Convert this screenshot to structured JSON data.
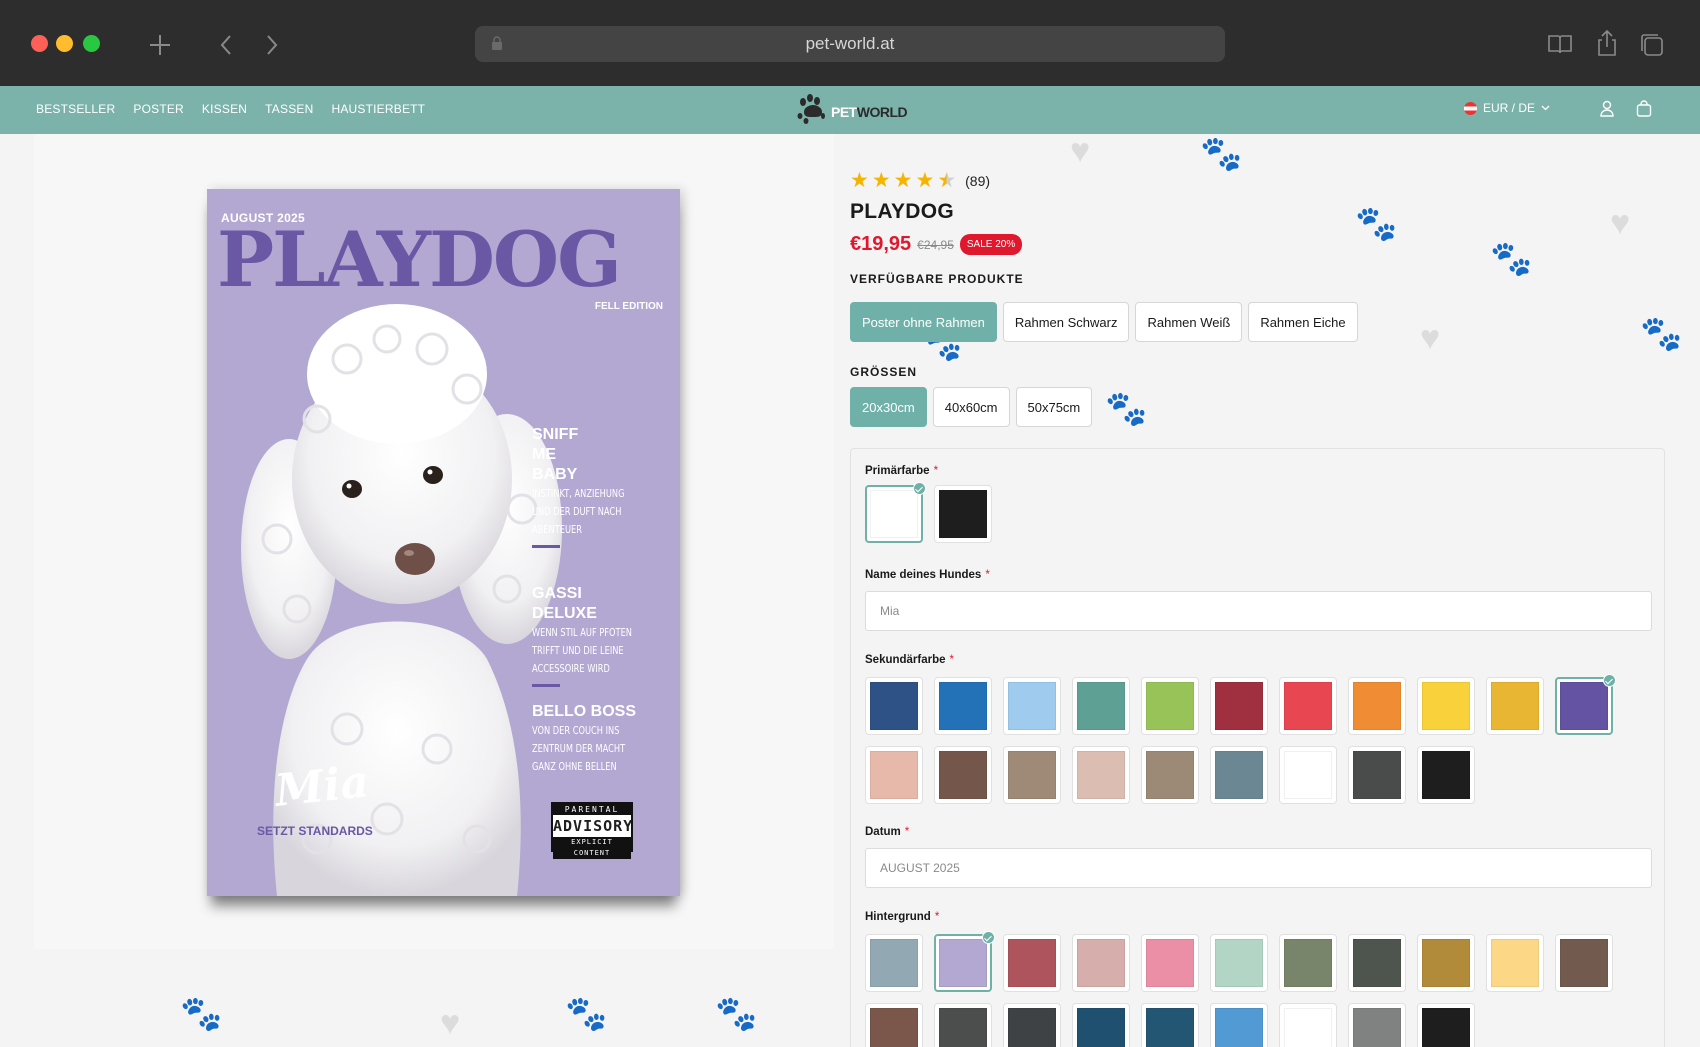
{
  "browser": {
    "url": "pet-world.at"
  },
  "nav": {
    "links": [
      "BESTSELLER",
      "POSTER",
      "KISSEN",
      "TASSEN",
      "HAUSTIERBETT"
    ],
    "logo_pet": "PET",
    "logo_world": "WORLD",
    "locale": "EUR / DE"
  },
  "poster": {
    "date": "AUGUST 2025",
    "title": "PLAYDOG",
    "edition": "FELL EDITION",
    "headlines": [
      {
        "title1": "SNIFF",
        "title2": "ME",
        "title3": "BABY",
        "sub1": "INSTINKT, ANZIEHUNG",
        "sub2": "UND DER DUFT NACH",
        "sub3": "ABENTEUER"
      },
      {
        "title1": "GASSI",
        "title2": "DELUXE",
        "sub1": "WENN STIL AUF PFOTEN",
        "sub2": "TRIFFT UND DIE LEINE",
        "sub3": "ACCESSOIRE WIRD"
      },
      {
        "title1": "BELLO BOSS",
        "sub1": "VON DER COUCH INS",
        "sub2": "ZENTRUM DER MACHT",
        "sub3": "GANZ OHNE BELLEN"
      }
    ],
    "name": "Mia",
    "tagline": "SETZT STANDARDS",
    "advisory": {
      "top": "PARENTAL",
      "mid": "ADVISORY",
      "bottom": "EXPLICIT CONTENT"
    }
  },
  "product": {
    "rating_value": 4.5,
    "rating_count": "(89)",
    "title": "PLAYDOG",
    "price_now": "€19,95",
    "price_was": "€24,95",
    "sale_badge": "SALE 20%",
    "products_label": "VERFÜGBARE PRODUKTE",
    "products": [
      "Poster ohne Rahmen",
      "Rahmen Schwarz",
      "Rahmen Weiß",
      "Rahmen Eiche"
    ],
    "products_selected": "Poster ohne Rahmen",
    "sizes_label": "GRÖSSEN",
    "sizes": [
      "20x30cm",
      "40x60cm",
      "50x75cm"
    ],
    "size_selected": "20x30cm"
  },
  "form": {
    "primary_label": "Primärfarbe",
    "primary_colors": [
      "#ffffff",
      "#1e1e1e"
    ],
    "primary_selected": 0,
    "name_label": "Name deines Hundes",
    "name_value": "Mia",
    "secondary_label": "Sekundärfarbe",
    "secondary_colors": [
      "#2f5286",
      "#2372b8",
      "#9ecbee",
      "#5fa094",
      "#98c358",
      "#a0303f",
      "#e84651",
      "#f08d34",
      "#f9d23b",
      "#e9b633",
      "#6353a2",
      "#e6b9ab",
      "#74574a",
      "#9e8a77",
      "#dcbdb2",
      "#9c8a77",
      "#6c8794",
      "#ffffff",
      "#4a4b4b",
      "#1e1e1e"
    ],
    "secondary_selected": 10,
    "date_label": "Datum",
    "date_value": "AUGUST 2025",
    "background_label": "Hintergrund",
    "background_colors": [
      "#92a8b2",
      "#b3a8d2",
      "#ad545c",
      "#d6aeab",
      "#ea8fa5",
      "#b2d5c5",
      "#78856a",
      "#4e554f",
      "#b18a3a",
      "#fbd786",
      "#725a4e",
      "#7a574a",
      "#4c4d4d",
      "#3f4244",
      "#1f5070",
      "#225673",
      "#529ad3",
      "#ffffff",
      "#808181",
      "#1e1e1e"
    ],
    "background_selected": 1
  }
}
